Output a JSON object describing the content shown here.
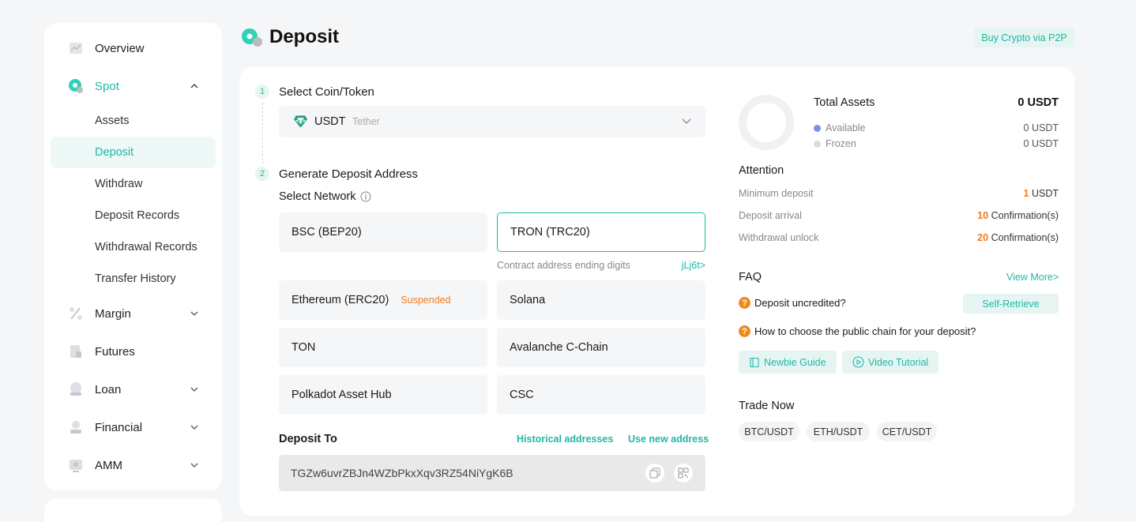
{
  "sidebar": {
    "items": [
      {
        "label": "Overview",
        "icon": "overview-icon"
      },
      {
        "label": "Spot",
        "icon": "spot-icon",
        "expanded": true
      },
      {
        "label": "Margin",
        "icon": "margin-icon"
      },
      {
        "label": "Futures",
        "icon": "futures-icon"
      },
      {
        "label": "Loan",
        "icon": "loan-icon"
      },
      {
        "label": "Financial",
        "icon": "financial-icon"
      },
      {
        "label": "AMM",
        "icon": "amm-icon"
      }
    ],
    "spot_sub": [
      "Assets",
      "Deposit",
      "Withdraw",
      "Deposit Records",
      "Withdrawal Records",
      "Transfer History"
    ],
    "selected_sub": "Deposit"
  },
  "header": {
    "title": "Deposit",
    "p2p_button": "Buy Crypto via P2P"
  },
  "step1": {
    "num": "1",
    "label": "Select Coin/Token"
  },
  "coin": {
    "symbol": "USDT",
    "name": "Tether"
  },
  "step2": {
    "num": "2",
    "label": "Generate Deposit Address"
  },
  "network": {
    "label": "Select Network",
    "options": [
      {
        "name": "BSC (BEP20)"
      },
      {
        "name": "TRON (TRC20)",
        "selected": true
      },
      {
        "name": "Ethereum (ERC20)",
        "status": "Suspended"
      },
      {
        "name": "Solana"
      },
      {
        "name": "TON"
      },
      {
        "name": "Avalanche C-Chain"
      },
      {
        "name": "Polkadot Asset Hub"
      },
      {
        "name": "CSC"
      }
    ],
    "contract_label": "Contract address ending digits",
    "contract_digits": "jLj6t>"
  },
  "deposit_to": {
    "label": "Deposit To",
    "historical": "Historical addresses",
    "new_address": "Use new address",
    "address": "TGZw6uvrZBJn4WZbPkxXqv3RZ54NiYgK6B"
  },
  "assets": {
    "title": "Total Assets",
    "total": "0 USDT",
    "available_label": "Available",
    "available": "0 USDT",
    "frozen_label": "Frozen",
    "frozen": "0 USDT",
    "available_color": "#7b8ff0",
    "frozen_color": "#dcdcdc"
  },
  "attention": {
    "title": "Attention",
    "rows": [
      {
        "label": "Minimum deposit",
        "num": "1",
        "unit": "USDT"
      },
      {
        "label": "Deposit arrival",
        "num": "10",
        "unit": "Confirmation(s)"
      },
      {
        "label": "Withdrawal unlock",
        "num": "20",
        "unit": "Confirmation(s)"
      }
    ]
  },
  "faq": {
    "title": "FAQ",
    "view_more": "View More>",
    "q1": "Deposit uncredited?",
    "self_retrieve": "Self-Retrieve",
    "q2": "How to choose the public chain for your deposit?",
    "newbie": "Newbie Guide",
    "video": "Video Tutorial"
  },
  "trade": {
    "title": "Trade Now",
    "pairs": [
      "BTC/USDT",
      "ETH/USDT",
      "CET/USDT"
    ]
  },
  "colors": {
    "accent": "#1fb8a5",
    "warning": "#f07a1f"
  }
}
